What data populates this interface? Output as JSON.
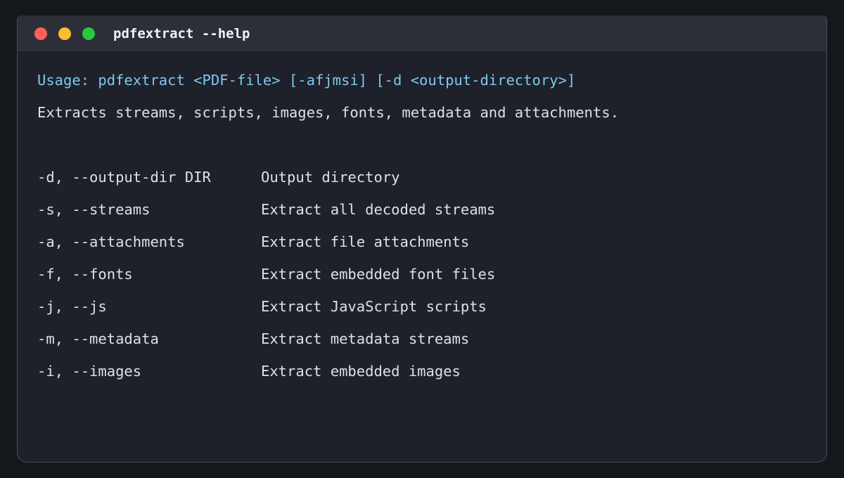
{
  "window": {
    "title": "pdfextract --help",
    "traffic_lights": {
      "close_color": "#ff5f57",
      "minimize_color": "#febc2e",
      "maximize_color": "#28c840"
    }
  },
  "terminal": {
    "usage": "Usage: pdfextract <PDF-file> [-afjmsi] [-d <output-directory>]",
    "description": "Extracts streams, scripts, images, fonts, metadata and attachments.",
    "usage_color": "#7cc9f2",
    "options": [
      {
        "flag": "-d, --output-dir DIR",
        "description": "Output directory"
      },
      {
        "flag": "-s, --streams",
        "description": "Extract all decoded streams"
      },
      {
        "flag": "-a, --attachments",
        "description": "Extract file attachments"
      },
      {
        "flag": "-f, --fonts",
        "description": "Extract embedded font files"
      },
      {
        "flag": "-j, --js",
        "description": "Extract JavaScript scripts"
      },
      {
        "flag": "-m, --metadata",
        "description": "Extract metadata streams"
      },
      {
        "flag": "-i, --images",
        "description": "Extract embedded images"
      }
    ]
  }
}
